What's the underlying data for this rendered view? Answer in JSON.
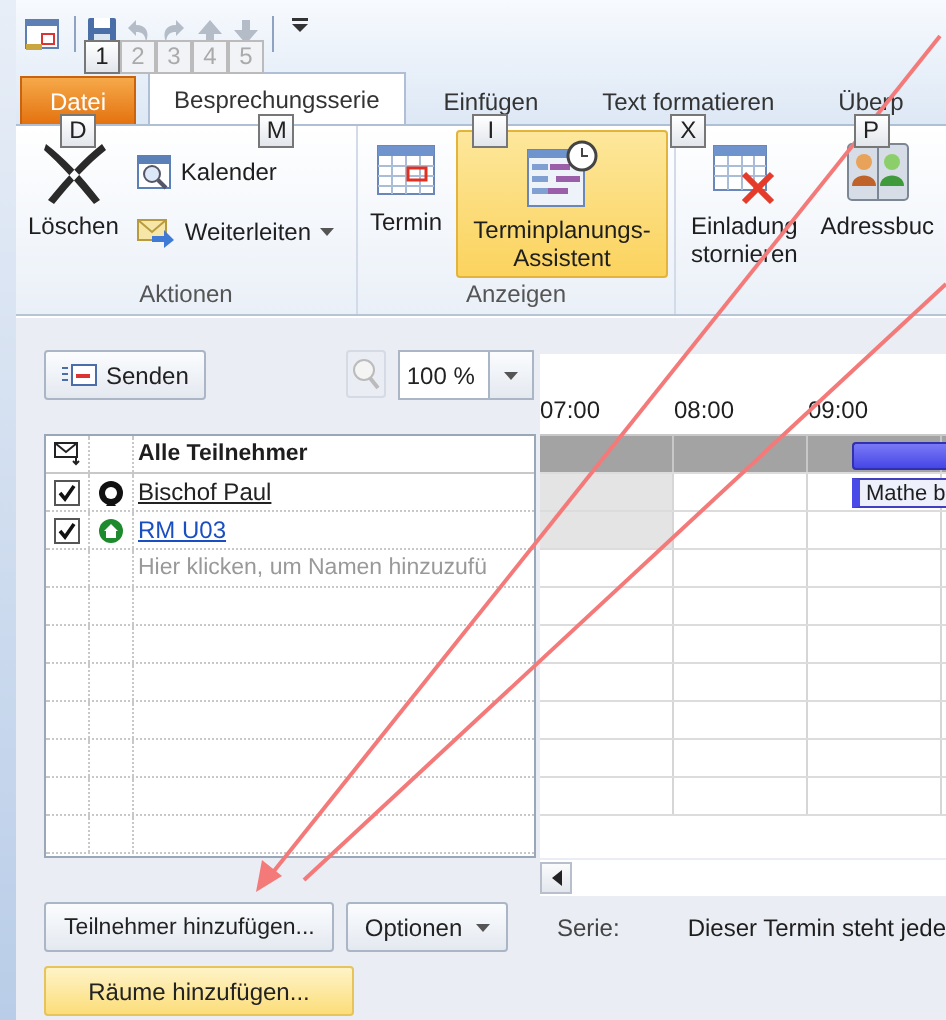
{
  "quick_access": [
    {
      "kind": "app"
    },
    {
      "kind": "save",
      "keytip": "1",
      "disabled": false
    },
    {
      "kind": "undo",
      "keytip": "2",
      "disabled": true
    },
    {
      "kind": "redo",
      "keytip": "3",
      "disabled": true
    },
    {
      "kind": "up",
      "keytip": "4",
      "disabled": true
    },
    {
      "kind": "down",
      "keytip": "5",
      "disabled": true
    },
    {
      "kind": "customize"
    }
  ],
  "tabs": [
    {
      "label": "Datei",
      "kind": "file",
      "keytip": "D",
      "selected": false
    },
    {
      "label": "Besprechungsserie",
      "kind": "tab",
      "keytip": "M",
      "selected": true
    },
    {
      "label": "Einfügen",
      "kind": "tab",
      "keytip": "I",
      "selected": false
    },
    {
      "label": "Text formatieren",
      "kind": "tab",
      "keytip": "X",
      "selected": false
    },
    {
      "label": "Überp",
      "kind": "tab",
      "keytip": "P",
      "selected": false
    }
  ],
  "ribbon": {
    "groups": [
      {
        "label": "Aktionen",
        "commands": [
          {
            "label": "Löschen",
            "kind": "large",
            "selected": false
          },
          {
            "label": "Kalender",
            "kind": "small",
            "dropdown": false
          },
          {
            "label": "Weiterleiten",
            "kind": "small",
            "dropdown": true
          }
        ]
      },
      {
        "label": "Anzeigen",
        "commands": [
          {
            "label": "Termin",
            "kind": "large",
            "selected": false
          },
          {
            "label": "Terminplanungs-Assistent",
            "kind": "large",
            "selected": true
          }
        ]
      },
      {
        "commands": [
          {
            "label": "Einladung stornieren",
            "kind": "large",
            "selected": false
          },
          {
            "label": "Adressbuc",
            "kind": "large",
            "selected": false
          }
        ]
      }
    ]
  },
  "send_button": "Senden",
  "zoom": {
    "value": "100 %"
  },
  "attendees": {
    "column_header": "Alle Teilnehmer",
    "rows": [
      {
        "name": "Bischof Paul",
        "kind": "person",
        "checked": true,
        "event": "Mathe b"
      },
      {
        "name": "RM U03",
        "kind": "room",
        "checked": true
      }
    ],
    "placeholder": "Hier klicken, um Namen hinzuzufü"
  },
  "timeline": {
    "hours": [
      "07:00",
      "08:00",
      "09:00"
    ]
  },
  "buttons": [
    {
      "label": "Teilnehmer hinzufügen...",
      "kind": "plain"
    },
    {
      "label": "Optionen",
      "kind": "dropdown"
    }
  ],
  "rooms_button": "Räume hinzufügen...",
  "series": {
    "label": "Serie:",
    "text": "Dieser Termin steht jede"
  }
}
